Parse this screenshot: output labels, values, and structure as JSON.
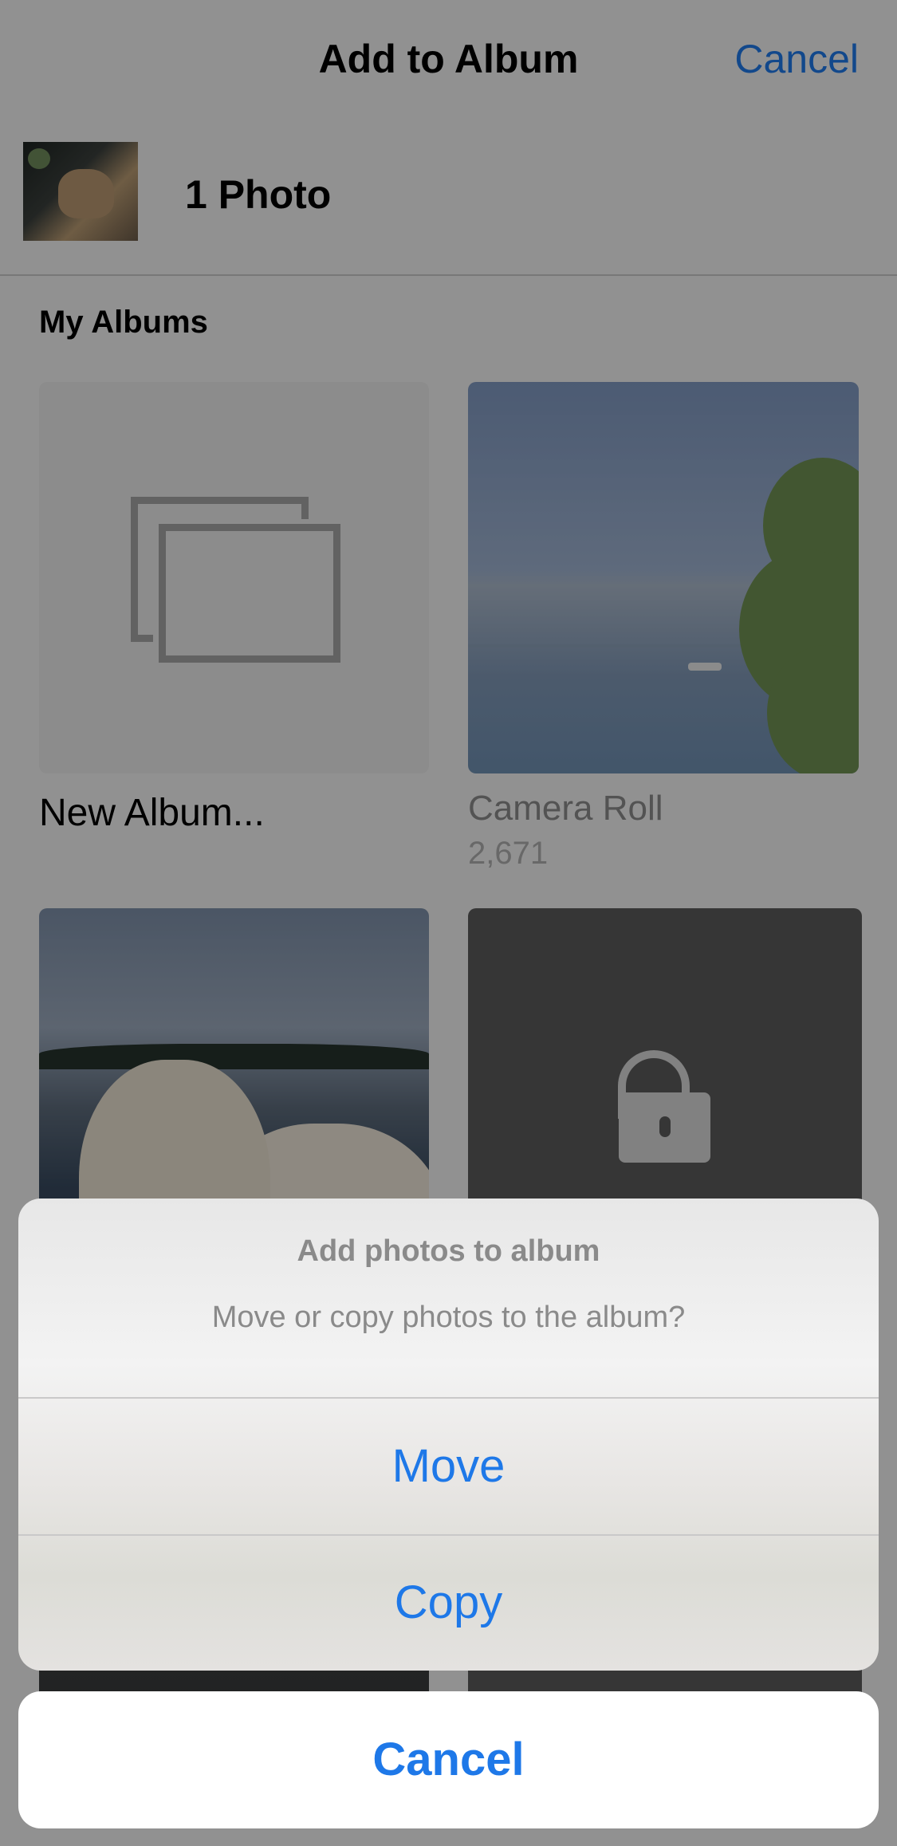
{
  "header": {
    "title": "Add to Album",
    "cancel_label": "Cancel"
  },
  "selection": {
    "count_label": "1 Photo"
  },
  "albums": {
    "section_title": "My Albums",
    "new_album_label": "New Album...",
    "items": [
      {
        "name": "Camera Roll",
        "count": "2,671"
      }
    ]
  },
  "action_sheet": {
    "title": "Add photos to album",
    "message": "Move or copy photos to the album?",
    "move_label": "Move",
    "copy_label": "Copy",
    "cancel_label": "Cancel"
  },
  "colors": {
    "accent": "#1e78e8",
    "background": "#f2f2f2"
  },
  "icons": {
    "new_album": "stacked-frames-icon",
    "locked_album": "lock-icon"
  }
}
